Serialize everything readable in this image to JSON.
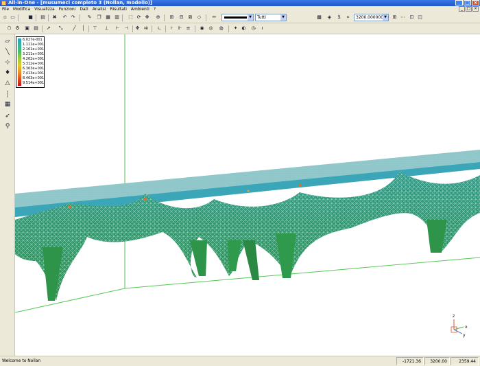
{
  "window": {
    "title": "All-in-One - [musumeci completo 3 (Nollan, modello)]",
    "controls": [
      "_",
      "□",
      "×"
    ]
  },
  "menu": [
    "File",
    "Modifica",
    "Visualizza",
    "Funzioni",
    "Dati",
    "Analisi",
    "Risultati",
    "Ambienti",
    "?"
  ],
  "mdi_controls": [
    "_",
    "□",
    "×"
  ],
  "toolbar": {
    "color_combo": "",
    "filter_combo": "Tutti",
    "value_combo": "3200.00000000"
  },
  "legend": [
    "6.027e-001",
    "1.111e+001",
    "2.161e+001",
    "3.211e+001",
    "4.262e+001",
    "5.312e+001",
    "6.363e+001",
    "7.413e+001",
    "8.463e+001",
    "9.514e+001"
  ],
  "axes": {
    "z": "z",
    "y": "y",
    "x": "x"
  },
  "status": {
    "message": "Welcome to Nollan",
    "x": "-1721.36",
    "y": "3200.00",
    "z": "2359.44"
  }
}
